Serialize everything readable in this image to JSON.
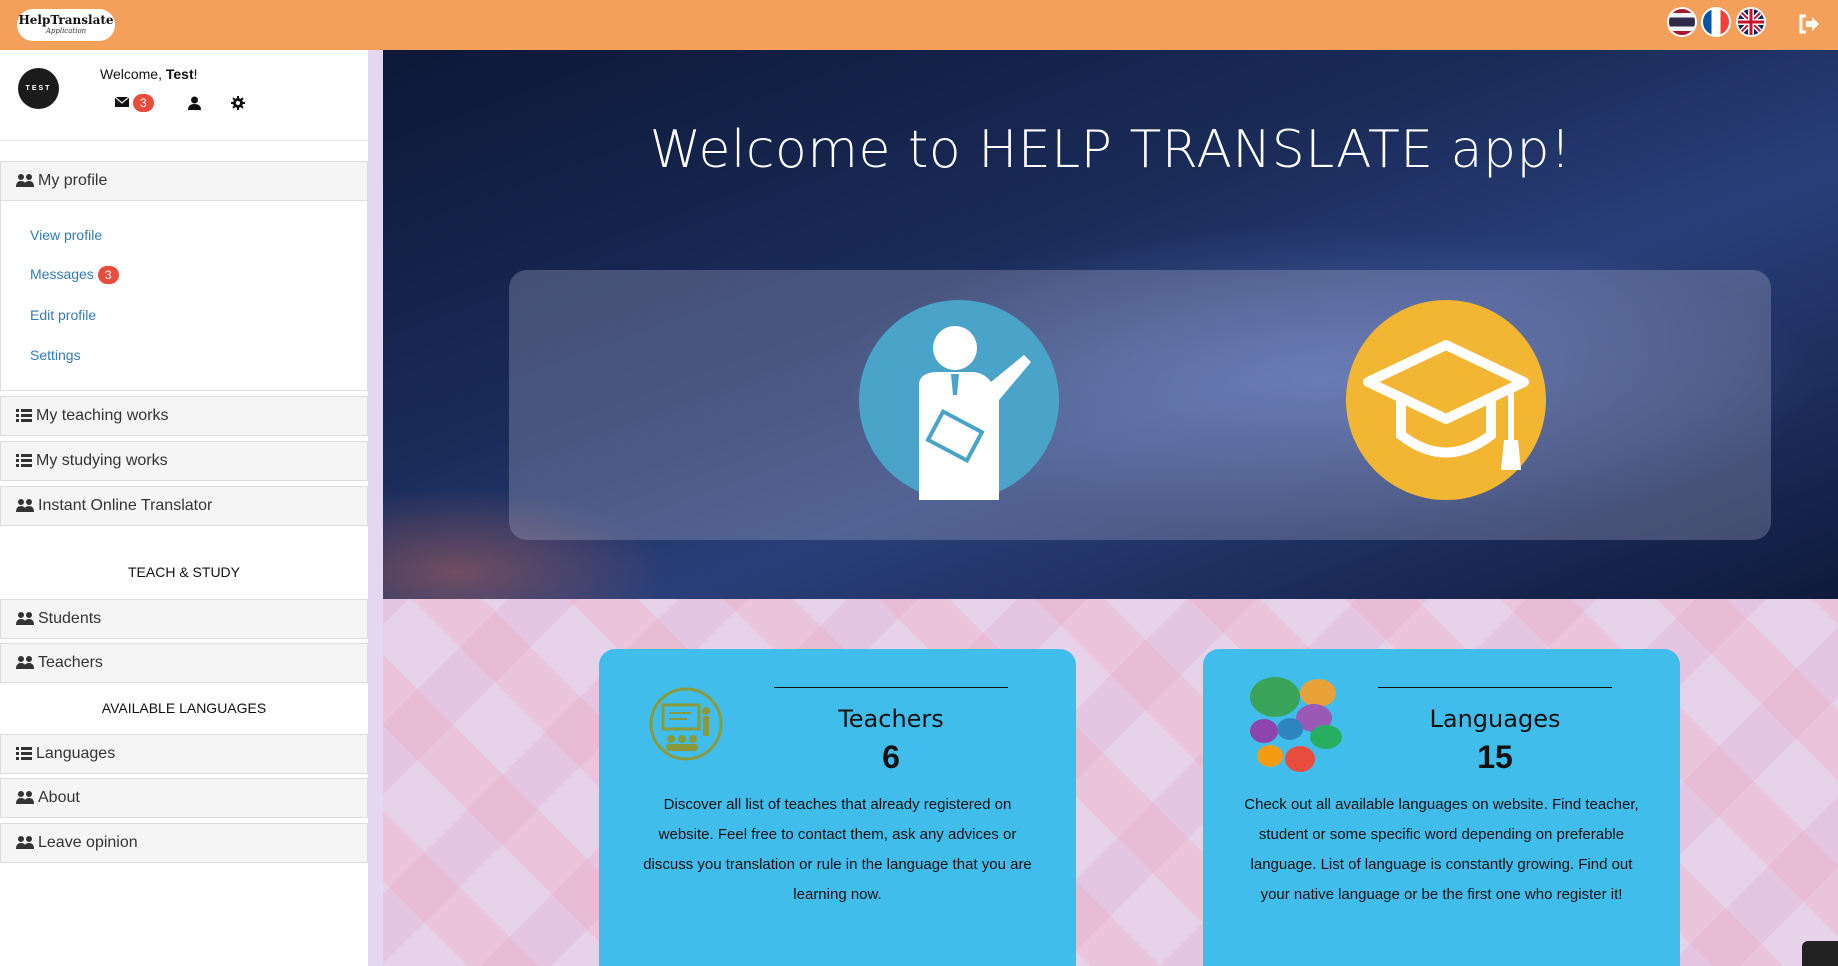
{
  "header": {
    "logo_title": "HelpTranslate",
    "logo_subtitle": "Application",
    "flags": [
      "flag-thailand-icon",
      "flag-france-icon",
      "flag-uk-icon"
    ],
    "colors": {
      "bar": "#f5a05a"
    }
  },
  "user": {
    "avatar_text": "TEST",
    "welcome_prefix": "Welcome, ",
    "name": "Test",
    "welcome_suffix": "!",
    "messages_count": "3"
  },
  "sidebar": {
    "my_profile": "My profile",
    "sublinks": {
      "view_profile": "View profile",
      "messages": "Messages",
      "messages_count": "3",
      "edit_profile": "Edit profile",
      "settings": "Settings"
    },
    "my_teaching_works": "My teaching works",
    "my_studying_works": "My studying works",
    "instant_translator": "Instant Online Translator",
    "teach_study_label": "TEACH & STUDY",
    "students": "Students",
    "teachers": "Teachers",
    "available_languages_label": "AVAILABLE LANGUAGES",
    "languages": "Languages",
    "about": "About",
    "leave_opinion": "Leave opinion"
  },
  "hero": {
    "title": "Welcome to HELP TRANSLATE app!"
  },
  "cards": {
    "teachers": {
      "title": "Teachers",
      "count": "6",
      "text": "Discover all list of teaches that already registered on website. Feel free to contact them, ask any advices or discuss you translation or rule in the language that you are learning now."
    },
    "languages": {
      "title": "Languages",
      "count": "15",
      "text": "Check out all available languages on website. Find teacher, student or some specific word depending on preferable language. List of language is constantly growing. Find out your native language or be the first one who register it!"
    }
  },
  "colors": {
    "accent_orange": "#f5a05a",
    "card_blue": "#41bdeb",
    "badge_red": "#e74c3c",
    "link_blue": "#337ab7",
    "teacher_circle": "#4aa3c9",
    "cap_circle": "#f2b632"
  }
}
